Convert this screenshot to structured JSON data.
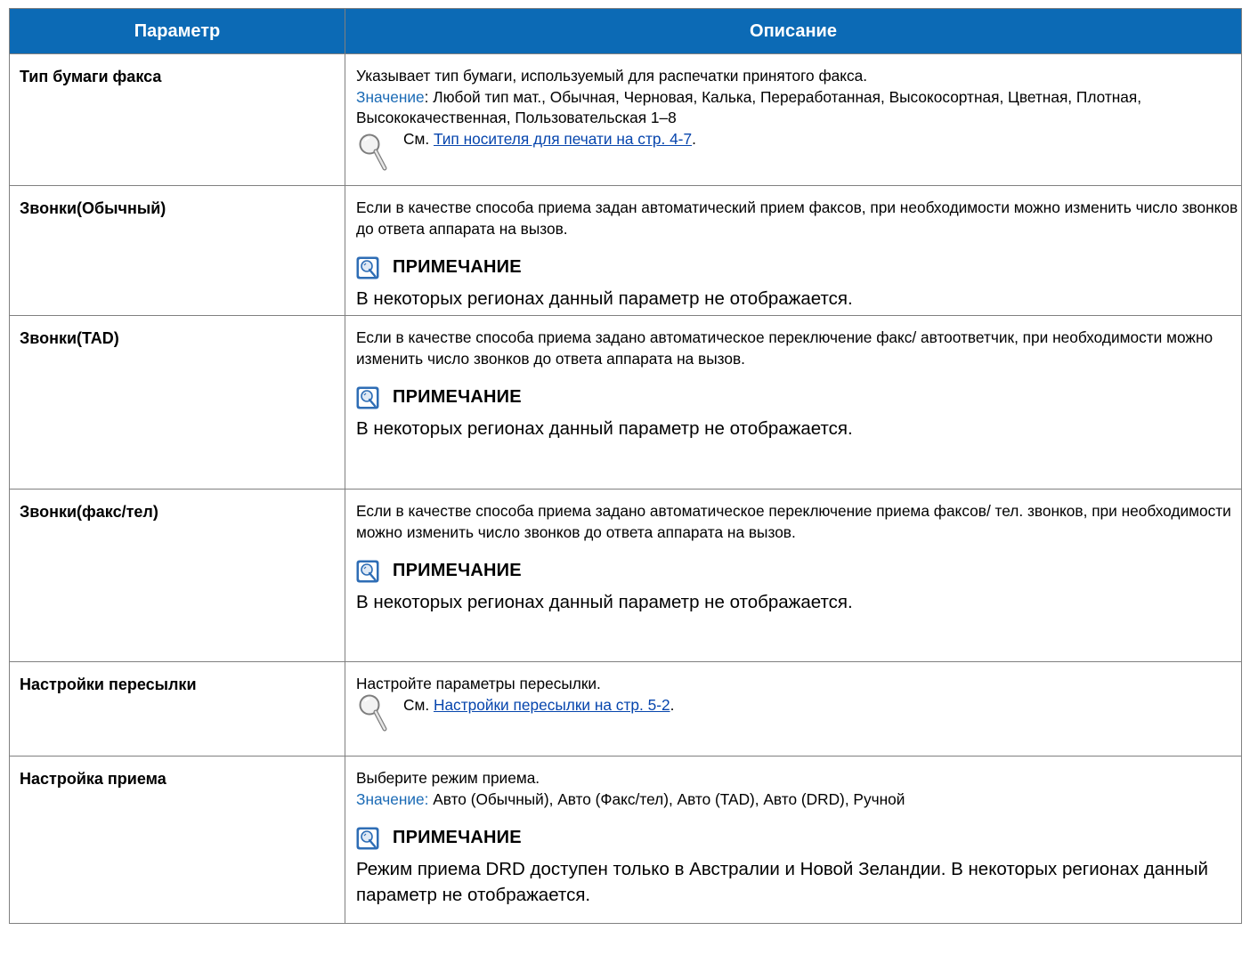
{
  "table": {
    "header": {
      "param": "Параметр",
      "desc": "Описание"
    },
    "rows": [
      {
        "param": "Тип бумаги факса",
        "text": "Указывает тип бумаги, используемый для распечатки принятого факса.",
        "value_label": "Значение",
        "value_text": ": Любой тип мат., Обычная, Черновая, Калька, Переработанная, Высокосортная, Цветная, Плотная, Высококачественная, Пользовательская 1–8",
        "see_prefix": "См. ",
        "see_link": "Тип носителя для печати на стр. 4-7",
        "see_suffix": "."
      },
      {
        "param": "Звонки(Обычный)",
        "text": "Если в качестве способа приема задан автоматический прием факсов, при необходимости можно изменить число звонков до ответа аппарата на вызов.",
        "note_title": "ПРИМЕЧАНИЕ",
        "note_text": "В некоторых регионах данный параметр не отображается."
      },
      {
        "param": "Звонки(TAD)",
        "text": "Если в качестве способа приема задано автоматическое переключение факс/ автоответчик, при необходимости можно изменить число звонков до ответа аппарата на вызов.",
        "note_title": "ПРИМЕЧАНИЕ",
        "note_text": "В некоторых регионах данный параметр не отображается."
      },
      {
        "param": "Звонки(факс/тел)",
        "text": "Если в качестве способа приема задано автоматическое переключение приема факсов/ тел. звонков, при необходимости можно изменить число звонков до ответа аппарата на вызов.",
        "note_title": "ПРИМЕЧАНИЕ",
        "note_text": "В некоторых регионах данный параметр не отображается."
      },
      {
        "param": "Настройки пересылки",
        "text": "Настройте параметры пересылки.",
        "see_prefix": "См. ",
        "see_link": "Настройки пересылки на стр. 5-2",
        "see_suffix": "."
      },
      {
        "param": "Настройка приема",
        "text": "Выберите режим приема.",
        "value_label": "Значение:",
        "value_text": " Авто (Обычный), Авто (Факс/тел), Авто (TAD), Авто (DRD), Ручной",
        "note_title": "ПРИМЕЧАНИЕ",
        "note_text": "Режим приема DRD доступен только в Австралии и Новой Зеландии. В некоторых регионах данный параметр не отображается."
      }
    ]
  },
  "icons": {
    "see": "magnifier-icon",
    "note": "note-lightbulb-icon"
  },
  "colors": {
    "header_bg": "#0c6ab5",
    "accent": "#1a6ab5",
    "link": "#0645ad"
  }
}
